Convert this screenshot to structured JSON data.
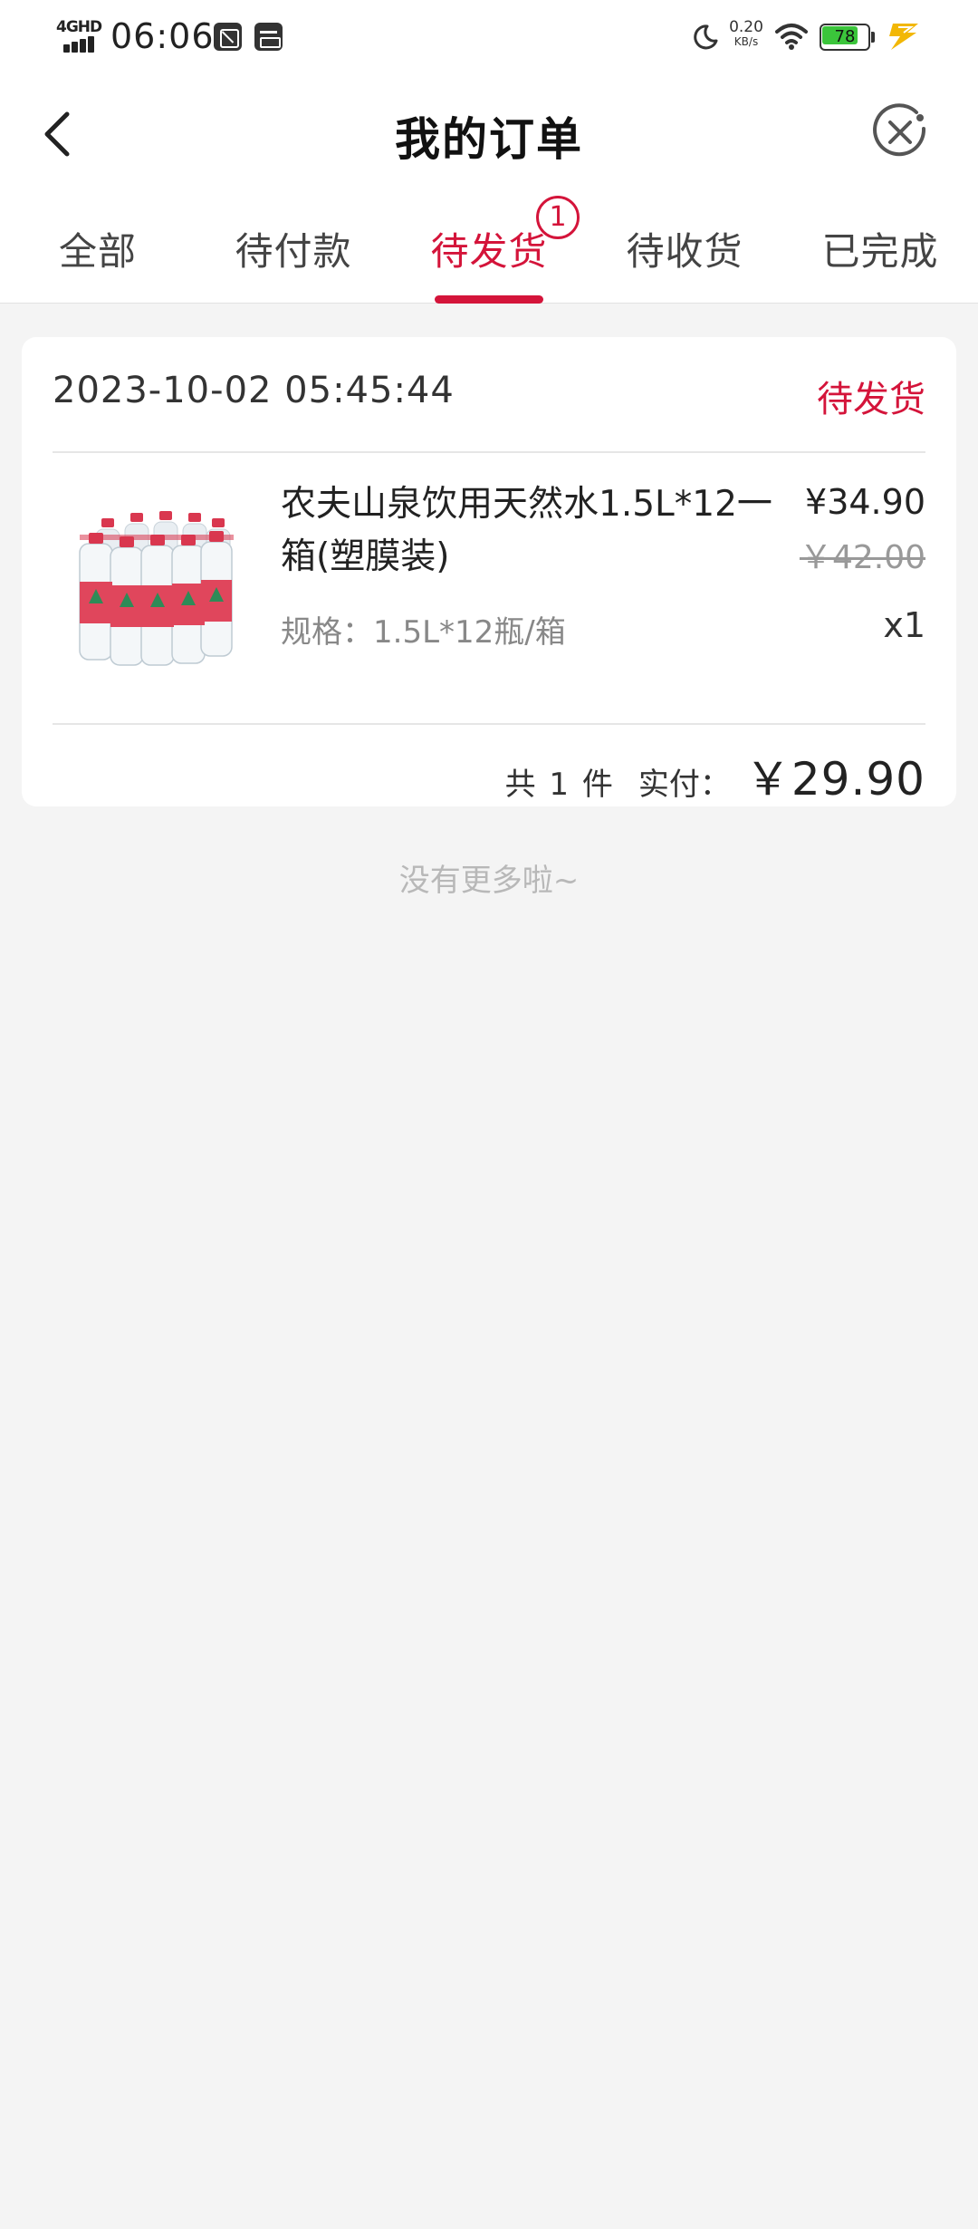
{
  "status_bar": {
    "network": "4GHD",
    "time": "06:06",
    "net_speed_value": "0.20",
    "net_speed_unit": "KB/s",
    "battery_level": "78",
    "battery_fraction": 0.78,
    "battery_color": "#3bc53b"
  },
  "header": {
    "title": "我的订单",
    "back_icon": "chevron-left-icon",
    "close_icon": "close-circle-icon"
  },
  "tabs": [
    {
      "label": "全部",
      "active": false
    },
    {
      "label": "待付款",
      "active": false
    },
    {
      "label": "待发货",
      "active": true,
      "badge": "1"
    },
    {
      "label": "待收货",
      "active": false
    },
    {
      "label": "已完成",
      "active": false
    }
  ],
  "accent_color": "#d4143a",
  "order": {
    "time": "2023-10-02 05:45:44",
    "status": "待发货",
    "product": {
      "name": "农夫山泉饮用天然水1.5L*12一箱(塑膜装)",
      "spec": "规格：1.5L*12瓶/箱",
      "price": "¥34.90",
      "original_price": "￥42.00",
      "quantity": "x1",
      "image": "water-bottles-pack"
    },
    "summary": {
      "count": "共 1 件",
      "paid_label": "实付：",
      "paid_amount": "￥29.90"
    }
  },
  "footer": {
    "no_more": "没有更多啦~"
  }
}
